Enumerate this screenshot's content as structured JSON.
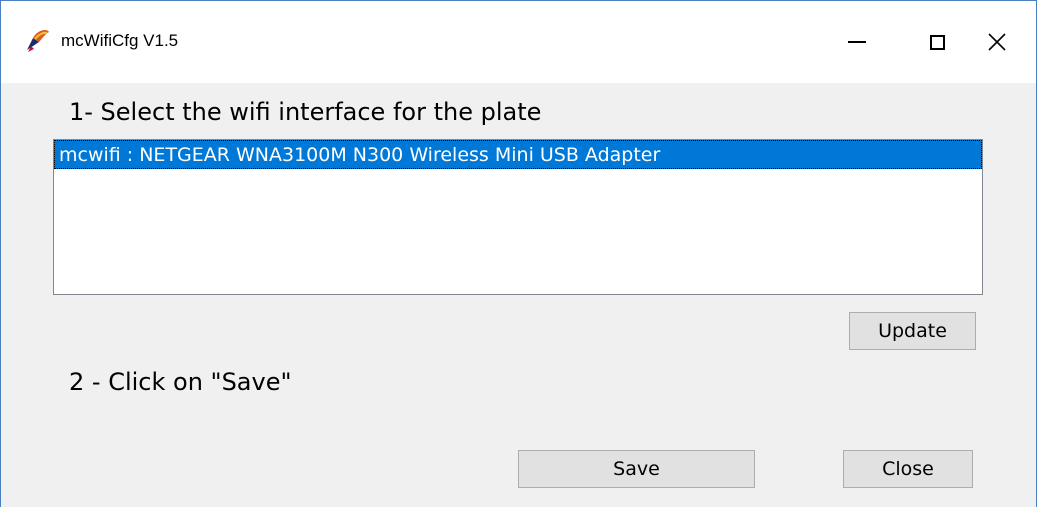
{
  "window": {
    "title": "mcWifiCfg V1.5",
    "icon": "app-icon",
    "controls": [
      "minimize-icon",
      "maximize-icon",
      "close-icon"
    ]
  },
  "steps": {
    "step1_label": "1- Select the wifi interface for the plate",
    "step2_label": "2 - Click on \"Save\""
  },
  "interface_list": {
    "items": [
      {
        "label": "mcwifi : NETGEAR WNA3100M N300 Wireless Mini USB Adapter",
        "selected": true
      }
    ]
  },
  "buttons": {
    "update": "Update",
    "save": "Save",
    "close": "Close"
  },
  "colors": {
    "selection": "#0078d7",
    "window_border": "#4a7fc1",
    "client_background": "#f0f0f0"
  }
}
